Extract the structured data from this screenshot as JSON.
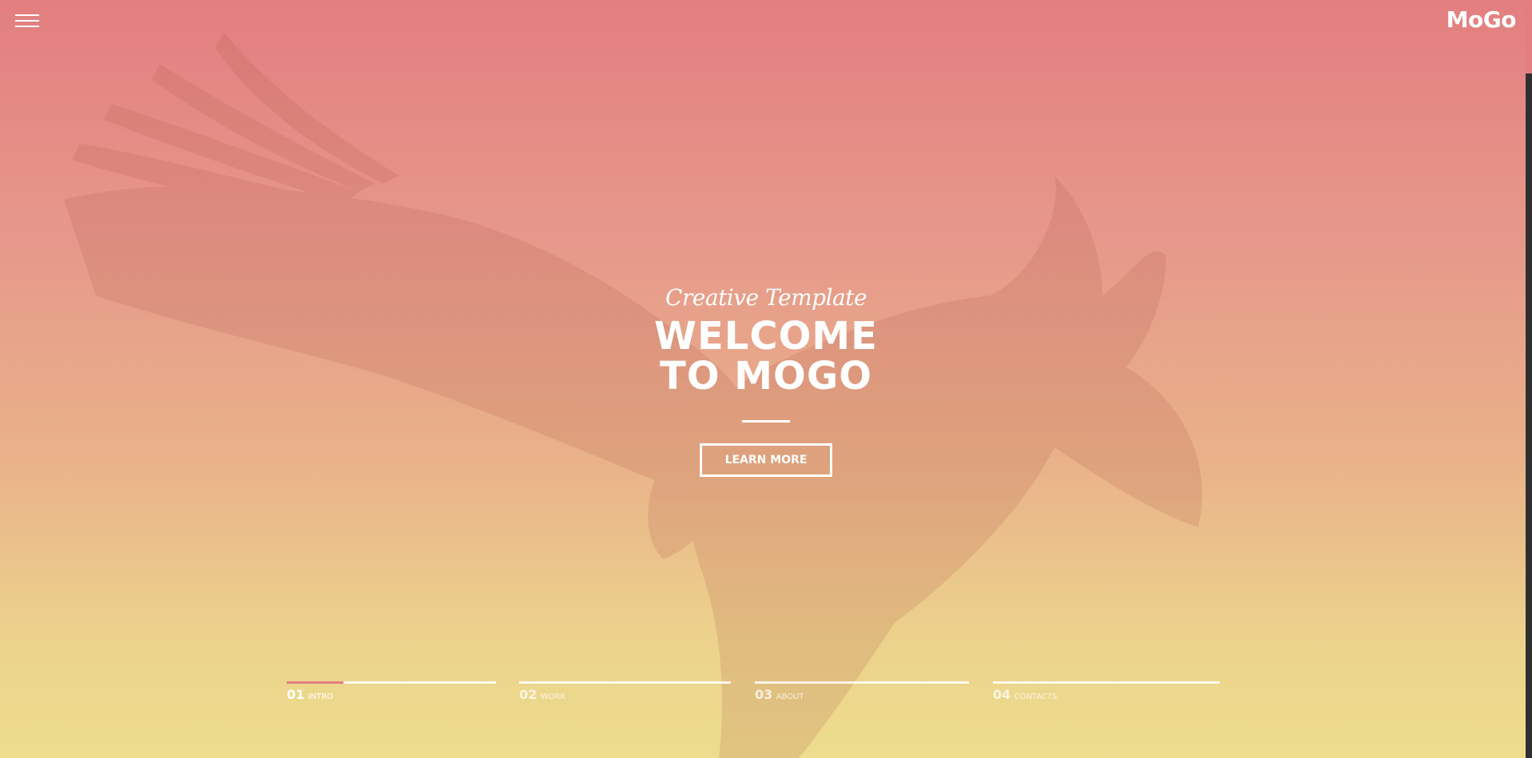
{
  "header": {
    "menu_icon": "hamburger-menu-icon",
    "logo_text": "MoGo"
  },
  "hero": {
    "subtitle": "Creative Template",
    "title_line1": "WELCOME",
    "title_line2": "TO MOGO",
    "button_label": "LEARN MORE"
  },
  "slider": {
    "active_index": 0,
    "active_progress": 0.27,
    "items": [
      {
        "number": "01",
        "label": "INTRO"
      },
      {
        "number": "02",
        "label": "WORK"
      },
      {
        "number": "03",
        "label": "ABOUT"
      },
      {
        "number": "04",
        "label": "CONTACTS"
      }
    ]
  },
  "colors": {
    "gradient_top": "#e37e80",
    "gradient_bottom": "#eddd8d",
    "accent": "#e37e80",
    "text": "#ffffff"
  }
}
